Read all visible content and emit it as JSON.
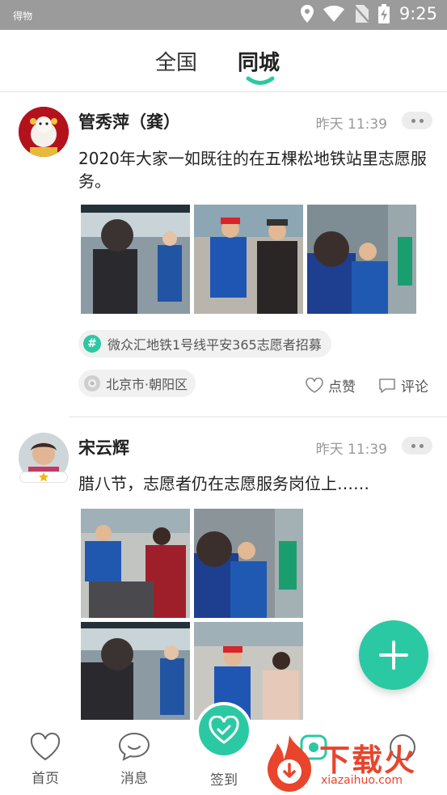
{
  "status_bar": {
    "carrier": "得物",
    "time": "9:25"
  },
  "tabs": [
    {
      "label": "全国"
    },
    {
      "label": "同城"
    }
  ],
  "posts": [
    {
      "user": "管秀萍（龚）",
      "time": "昨天 11:39",
      "content": "2020年大家一如既往的在五棵松地铁站里志愿服务。",
      "topic": "微众汇地铁1号线平安365志愿者招募",
      "location": "北京市·朝阳区",
      "like_label": "点赞",
      "comment_label": "评论"
    },
    {
      "user": "宋云辉",
      "time": "昨天 11:39",
      "content": "腊八节，志愿者仍在志愿服务岗位上……"
    }
  ],
  "bottom_nav": {
    "home": "首页",
    "messages": "消息",
    "checkin": "签到"
  },
  "watermark": {
    "text": "下载火",
    "url": "xiazaihuo.com"
  },
  "colors": {
    "accent": "#2bc9a3",
    "watermark": "#e8452c"
  }
}
